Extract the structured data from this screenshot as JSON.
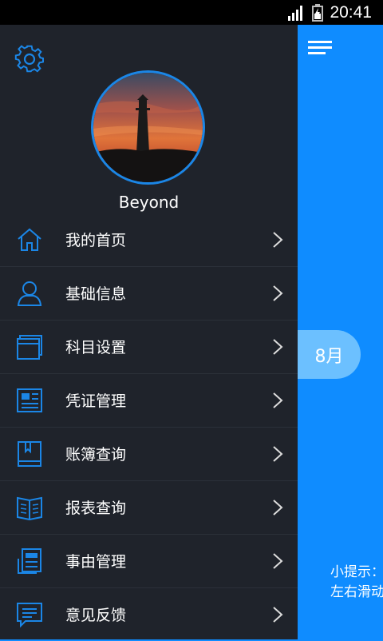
{
  "status_bar": {
    "time": "20:41",
    "icons": [
      "signal-icon",
      "battery-icon"
    ]
  },
  "drawer": {
    "settings_icon": "gear-icon",
    "avatar_image": "lighthouse-sunset",
    "username": "Beyond",
    "menu": [
      {
        "label": "我的首页",
        "icon": "home-icon"
      },
      {
        "label": "基础信息",
        "icon": "user-icon"
      },
      {
        "label": "科目设置",
        "icon": "window-icon"
      },
      {
        "label": "凭证管理",
        "icon": "voucher-icon"
      },
      {
        "label": "账簿查询",
        "icon": "ledger-icon"
      },
      {
        "label": "报表查询",
        "icon": "book-open-icon"
      },
      {
        "label": "事由管理",
        "icon": "document-icon"
      },
      {
        "label": "意见反馈",
        "icon": "chat-icon"
      }
    ]
  },
  "main": {
    "menu_icon": "hamburger-icon",
    "month": "8月",
    "tip_line1": "小提示：",
    "tip_line2": "左右滑动"
  },
  "colors": {
    "accent": "#0f8cff",
    "drawer_bg": "#1f232b",
    "icon_blue": "#1b86e6",
    "pill": "#6cc0ff"
  }
}
